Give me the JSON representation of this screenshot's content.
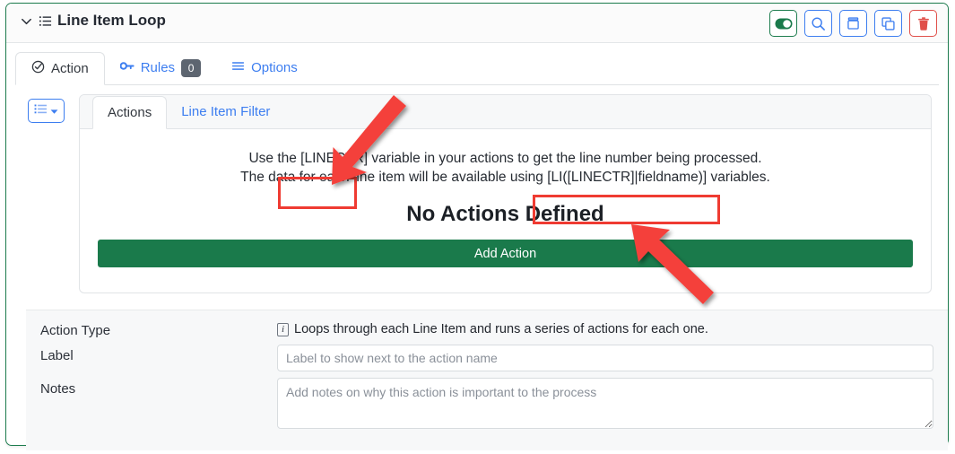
{
  "header": {
    "title": "Line Item Loop",
    "collapse_icon": "chevron-down-icon",
    "type_icon": "list-lines-icon",
    "buttons": [
      {
        "name": "enabled-toggle",
        "icon": "toggle-on-icon",
        "style": "green"
      },
      {
        "name": "search-button",
        "icon": "magnifier-icon",
        "style": "blue"
      },
      {
        "name": "archive-button",
        "icon": "archive-box-icon",
        "style": "blue"
      },
      {
        "name": "duplicate-button",
        "icon": "copy-icon",
        "style": "blue"
      },
      {
        "name": "delete-button",
        "icon": "trash-icon",
        "style": "red"
      }
    ]
  },
  "tabs": [
    {
      "label": "Action",
      "icon": "check-circle-icon",
      "active": true,
      "badge": null
    },
    {
      "label": "Rules",
      "icon": "key-icon",
      "active": false,
      "badge": "0"
    },
    {
      "label": "Options",
      "icon": "hamburger-icon",
      "active": false,
      "badge": null
    }
  ],
  "toolbar": {
    "list_menu_icon": "list-icon",
    "list_menu_caret": "caret-down-icon"
  },
  "inner_tabs": [
    {
      "label": "Actions",
      "active": true
    },
    {
      "label": "Line Item Filter",
      "active": false
    }
  ],
  "panel": {
    "help_line_1": "Use the [LINECTR] variable in your actions to get the line number being processed.",
    "help_line_2": "The data for each line item will be available using [LI([LINECTR]|fieldname)] variables.",
    "help_line_1_parts": {
      "before": "Use the ",
      "highlight": "[LINECTR]",
      "after": " variable in your actions to get the line number being processed."
    },
    "help_line_2_parts": {
      "before": "The data for each line item will be available using ",
      "highlight": "[LI([LINECTR]|fieldname)]",
      "after": " variables."
    },
    "empty_state": "No Actions Defined",
    "add_action_label": "Add Action"
  },
  "form": {
    "action_type": {
      "label": "Action Type",
      "info_icon": "info-icon",
      "description": "Loops through each Line Item and runs a series of actions for each one."
    },
    "label_field": {
      "label": "Label",
      "value": "",
      "placeholder": "Label to show next to the action name"
    },
    "notes_field": {
      "label": "Notes",
      "value": "",
      "placeholder": "Add notes on why this action is important to the process"
    }
  },
  "annotations": {
    "box_1_target": "[LINECTR]",
    "box_2_target": "[LI([LINECTR]|fieldname)]",
    "arrow_1": "red-arrow-pointing-down-left",
    "arrow_2": "red-arrow-pointing-up-left",
    "color": "#ef3b32"
  },
  "colors": {
    "brand_green": "#1e7d4f",
    "button_green": "#1a7a4b",
    "link_blue": "#3d7ef0",
    "danger_red": "#e0504a",
    "badge_gray": "#5d6570",
    "annotation_red": "#ef3b32"
  }
}
